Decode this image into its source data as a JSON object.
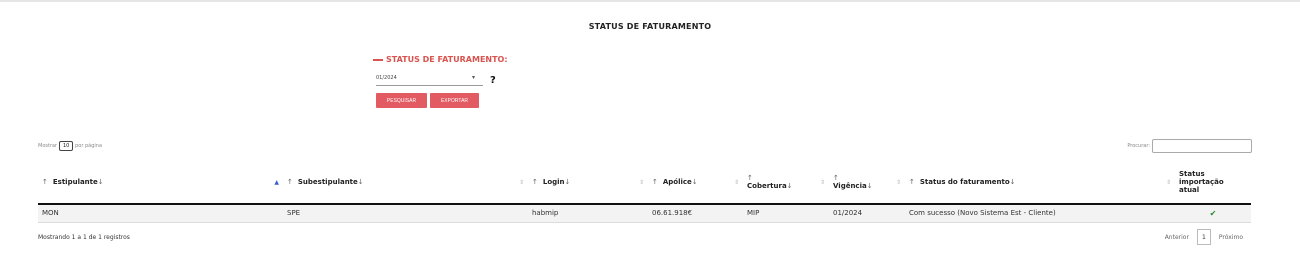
{
  "page": {
    "title": "STATUS DE FATURAMENTO"
  },
  "filter": {
    "title": "STATUS DE FATURAMENTO:",
    "period_value": "01/2024",
    "help": "?",
    "search_label": "PESQUISAR",
    "export_label": "EXPORTAR"
  },
  "table_controls": {
    "show_prefix": "Mostrar",
    "page_length": "10",
    "show_suffix": "por página",
    "search_label": "Procurar:"
  },
  "table": {
    "columns": [
      {
        "label": "Estipulante",
        "up": "↑",
        "down": "↓"
      },
      {
        "label": "Subestipulante",
        "up": "↑",
        "down": "↓"
      },
      {
        "label": "Login",
        "up": "↑",
        "down": "↓"
      },
      {
        "label": "Apólice",
        "up": "↑",
        "down": "↓"
      },
      {
        "label": "Cobertura",
        "up": "↑",
        "down": "↓"
      },
      {
        "label": "Vigência",
        "up": "↑",
        "down": "↓"
      },
      {
        "label": "Status do faturamento",
        "up": "↑",
        "down": "↓"
      },
      {
        "label_line1": "Status",
        "label_line2": "importação",
        "label_line3": "atual"
      }
    ],
    "rows": [
      {
        "estipulante": "MON",
        "subestipulante": "SPE",
        "login": "habmip",
        "apolice": "06.61.918€",
        "cobertura": "MIP",
        "vigencia": "01/2024",
        "status": "Com sucesso (Novo Sistema Est - Cliente)",
        "import_icon": "check-icon"
      }
    ]
  },
  "footer": {
    "info": "Mostrando 1 a 1 de 1 registros",
    "prev": "Anterior",
    "page": "1",
    "next": "Próximo"
  },
  "colors": {
    "accent": "#e25a62",
    "filter_title": "#d9534f",
    "success": "#2e8b2e"
  }
}
